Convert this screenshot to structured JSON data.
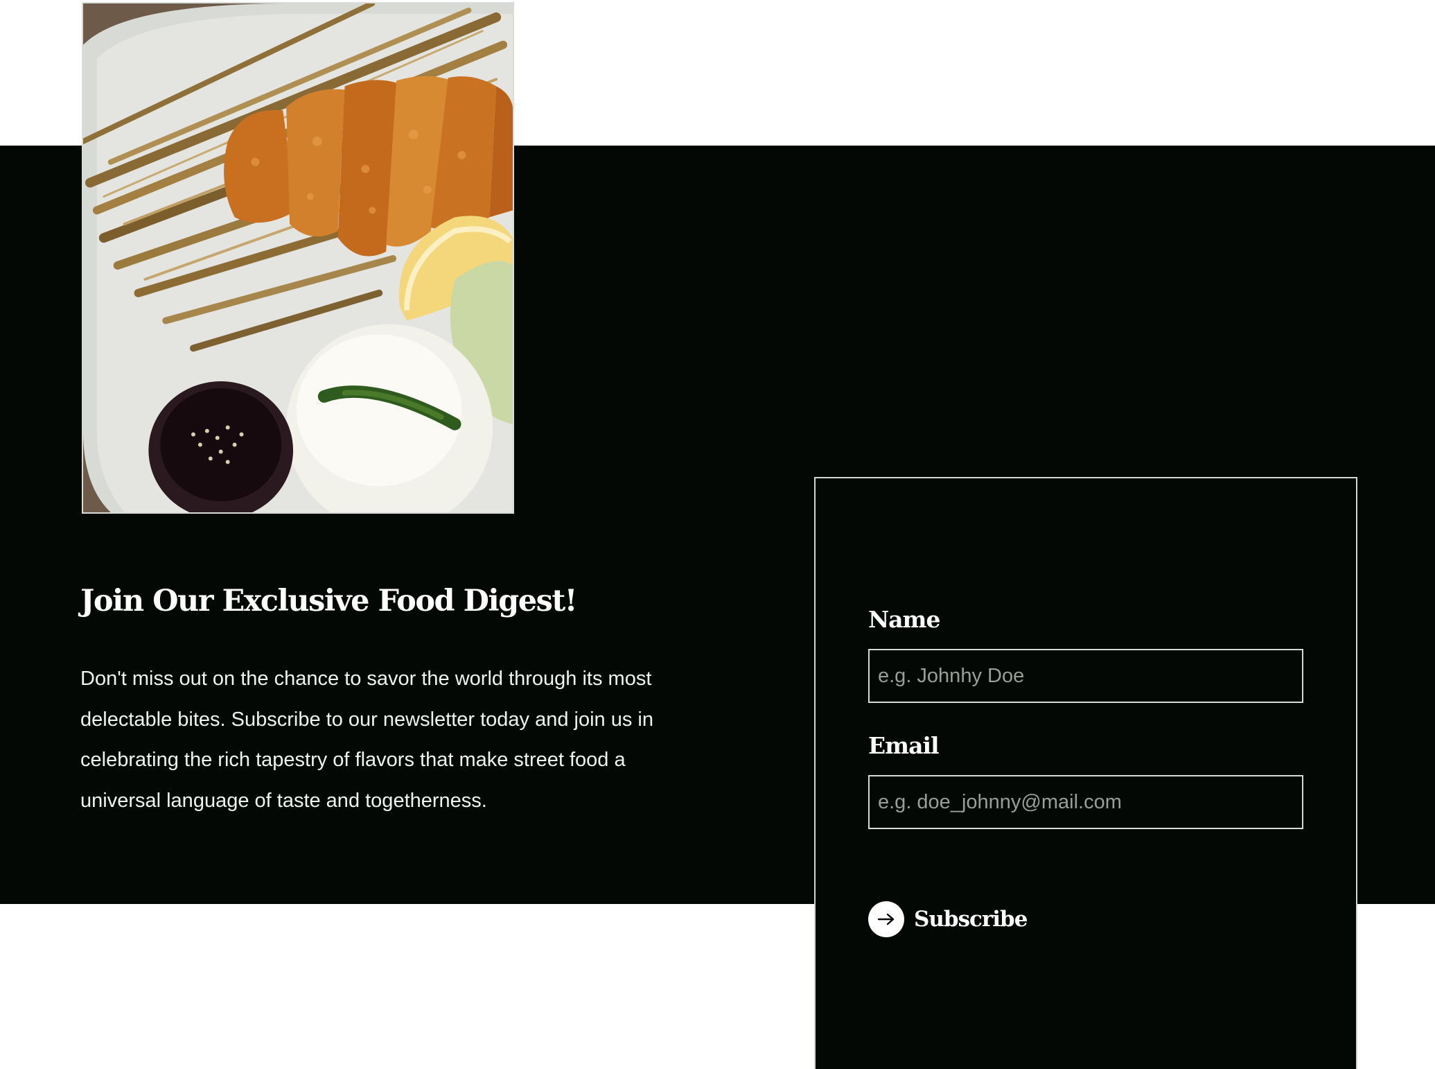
{
  "newsletter": {
    "title": "Join Our Exclusive Food Digest!",
    "description": "Don't miss out on the chance to savor the world through its most delectable bites. Subscribe to our newsletter today and join us in celebrating the rich tapestry of flavors that make street food a universal language of taste and togetherness.",
    "image_icon": "food-photo"
  },
  "form": {
    "name_label": "Name",
    "name_placeholder": "e.g. Johnhy Doe",
    "name_value": "",
    "email_label": "Email",
    "email_placeholder": "e.g. doe_johnny@mail.com",
    "email_value": "",
    "subscribe_label": "Subscribe",
    "subscribe_icon": "arrow-right-icon"
  },
  "colors": {
    "background_dark": "#030805",
    "text": "#ffffff",
    "border": "#d6d9d5"
  }
}
